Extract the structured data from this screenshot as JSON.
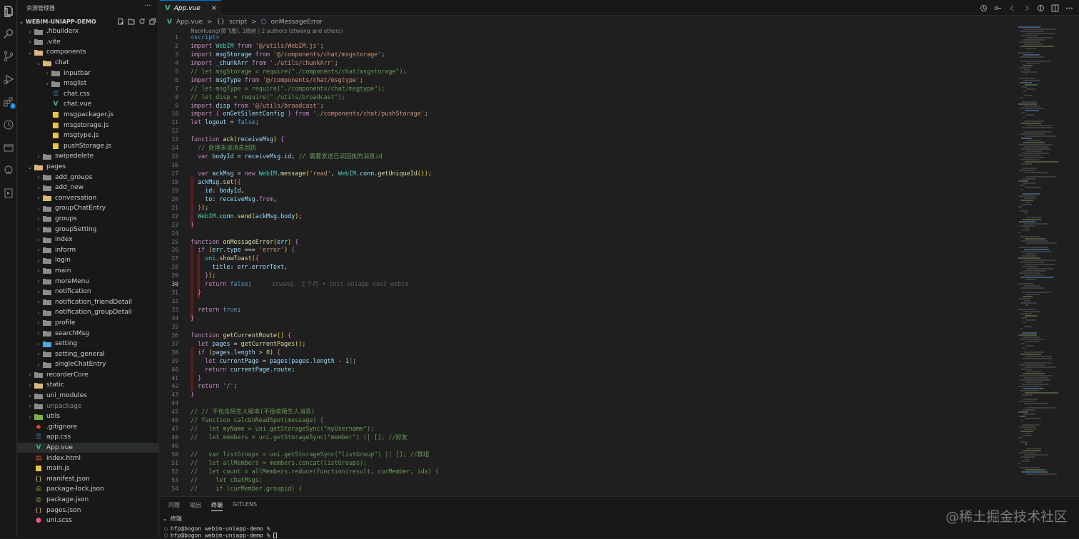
{
  "sidebar": {
    "title": "资源管理器",
    "more": "···",
    "project": "WEBIM-UNIAPP-DEMO",
    "tree": [
      {
        "label": "hbuilderx",
        "display": ".hbuilderx",
        "depth": 1,
        "kind": "folder",
        "open": false
      },
      {
        "label": ".vite",
        "display": ".vite",
        "depth": 1,
        "kind": "folder",
        "open": false
      },
      {
        "label": "components",
        "display": "components",
        "depth": 1,
        "kind": "folder-special",
        "open": true
      },
      {
        "label": "chat",
        "display": "chat",
        "depth": 2,
        "kind": "folder-special",
        "open": true
      },
      {
        "label": "inputbar",
        "display": "inputbar",
        "depth": 3,
        "kind": "folder",
        "open": false
      },
      {
        "label": "msglist",
        "display": "msglist",
        "depth": 3,
        "kind": "folder",
        "open": false
      },
      {
        "label": "chat.css",
        "display": "chat.css",
        "depth": 3,
        "kind": "css",
        "leaf": true
      },
      {
        "label": "chat.vue",
        "display": "chat.vue",
        "depth": 3,
        "kind": "vue",
        "leaf": true
      },
      {
        "label": "msgpackager.js",
        "display": "msgpackager.js",
        "depth": 3,
        "kind": "js",
        "leaf": true
      },
      {
        "label": "msgstorage.js",
        "display": "msgstorage.js",
        "depth": 3,
        "kind": "js",
        "leaf": true
      },
      {
        "label": "msgtype.js",
        "display": "msgtype.js",
        "depth": 3,
        "kind": "js",
        "leaf": true
      },
      {
        "label": "pushStorage.js",
        "display": "pushStorage.js",
        "depth": 3,
        "kind": "js",
        "leaf": true
      },
      {
        "label": "swipedelete",
        "display": "swipedelete",
        "depth": 2,
        "kind": "folder",
        "open": false
      },
      {
        "label": "pages",
        "display": "pages",
        "depth": 1,
        "kind": "folder-special",
        "open": true
      },
      {
        "label": "add_groups",
        "display": "add_groups",
        "depth": 2,
        "kind": "folder",
        "open": false
      },
      {
        "label": "add_new",
        "display": "add_new",
        "depth": 2,
        "kind": "folder",
        "open": false
      },
      {
        "label": "conversation",
        "display": "conversation",
        "depth": 2,
        "kind": "folder-special",
        "open": false
      },
      {
        "label": "groupChatEntry",
        "display": "groupChatEntry",
        "depth": 2,
        "kind": "folder",
        "open": false
      },
      {
        "label": "groups",
        "display": "groups",
        "depth": 2,
        "kind": "folder",
        "open": false
      },
      {
        "label": "groupSetting",
        "display": "groupSetting",
        "depth": 2,
        "kind": "folder",
        "open": false
      },
      {
        "label": "index",
        "display": "index",
        "depth": 2,
        "kind": "folder",
        "open": false
      },
      {
        "label": "inform",
        "display": "inform",
        "depth": 2,
        "kind": "folder",
        "open": false
      },
      {
        "label": "login",
        "display": "login",
        "depth": 2,
        "kind": "folder",
        "open": false
      },
      {
        "label": "main",
        "display": "main",
        "depth": 2,
        "kind": "folder",
        "open": false
      },
      {
        "label": "moreMenu",
        "display": "moreMenu",
        "depth": 2,
        "kind": "folder",
        "open": false
      },
      {
        "label": "notification",
        "display": "notification",
        "depth": 2,
        "kind": "folder",
        "open": false
      },
      {
        "label": "notification_friendDetail",
        "display": "notification_friendDetail",
        "depth": 2,
        "kind": "folder",
        "open": false
      },
      {
        "label": "notification_groupDetail",
        "display": "notification_groupDetail",
        "depth": 2,
        "kind": "folder",
        "open": false
      },
      {
        "label": "profile",
        "display": "profile",
        "depth": 2,
        "kind": "folder",
        "open": false
      },
      {
        "label": "searchMsg",
        "display": "searchMsg",
        "depth": 2,
        "kind": "folder",
        "open": false
      },
      {
        "label": "setting",
        "display": "setting",
        "depth": 2,
        "kind": "folder-setting",
        "open": false
      },
      {
        "label": "setting_general",
        "display": "setting_general",
        "depth": 2,
        "kind": "folder",
        "open": false
      },
      {
        "label": "singleChatEntry",
        "display": "singleChatEntry",
        "depth": 2,
        "kind": "folder",
        "open": false
      },
      {
        "label": "recorderCore",
        "display": "recorderCore",
        "depth": 1,
        "kind": "folder",
        "open": false
      },
      {
        "label": "static",
        "display": "static",
        "depth": 1,
        "kind": "folder-special",
        "open": false
      },
      {
        "label": "uni_modules",
        "display": "uni_modules",
        "depth": 1,
        "kind": "folder",
        "open": false
      },
      {
        "label": "unpackage",
        "display": "unpackage",
        "depth": 1,
        "kind": "folder",
        "open": false,
        "dim": true
      },
      {
        "label": "utils",
        "display": "utils",
        "depth": 1,
        "kind": "folder-green",
        "open": false
      },
      {
        "label": ".gitignore",
        "display": ".gitignore",
        "depth": 1,
        "kind": "git",
        "leaf": true
      },
      {
        "label": "app.css",
        "display": "app.css",
        "depth": 1,
        "kind": "css",
        "leaf": true
      },
      {
        "label": "App.vue",
        "display": "App.vue",
        "depth": 1,
        "kind": "vue",
        "leaf": true,
        "selected": true
      },
      {
        "label": "index.html",
        "display": "index.html",
        "depth": 1,
        "kind": "html",
        "leaf": true
      },
      {
        "label": "main.js",
        "display": "main.js",
        "depth": 1,
        "kind": "js",
        "leaf": true
      },
      {
        "label": "manifest.json",
        "display": "manifest.json",
        "depth": 1,
        "kind": "json",
        "leaf": true
      },
      {
        "label": "package-lock.json",
        "display": "package-lock.json",
        "depth": 1,
        "kind": "npm",
        "leaf": true
      },
      {
        "label": "package.json",
        "display": "package.json",
        "depth": 1,
        "kind": "npm",
        "leaf": true
      },
      {
        "label": "pages.json",
        "display": "pages.json",
        "depth": 1,
        "kind": "json",
        "leaf": true
      },
      {
        "label": "uni.scss",
        "display": "uni.scss",
        "depth": 1,
        "kind": "scss",
        "leaf": true
      }
    ]
  },
  "editor": {
    "tab_icon": "V",
    "tab_label": "App.vue",
    "tab_close": "×",
    "breadcrumb": {
      "file": "App.vue",
      "sep": ">",
      "section_icon": "{}",
      "section": "script",
      "symbol": "onMessageError"
    },
    "blame_header": "NeoHuang(黄飞鹏), 3周前 | 2 authors (stwang and others)",
    "current_line": 30,
    "inline_blame": "stwang, 上个月 • init uniapp vue3 webim",
    "lines": [
      "<script>",
      "import WebIM from '@/utils/WebIM.js';",
      "import msgStorage from '@/components/chat/msgstorage';",
      "import _chunkArr from './utils/chunkArr';",
      "// let msgStorage = require(\"./components/chat/msgstorage\");",
      "import msgType from '@/components/chat/msgtype';",
      "// let msgType = require(\"./components/chat/msgtype\");",
      "// let disp = require(\"./utils/broadcast\");",
      "import disp from '@/utils/broadcast';",
      "import { onGetSilentConfig } from './components/chat/pushStorage';",
      "let logout = false;",
      "",
      "function ack(receiveMsg) {",
      "  // 处理未读消息回执",
      "  var bodyId = receiveMsg.id; // 需要发送已读回执的消息id",
      "",
      "  var ackMsg = new WebIM.message('read', WebIM.conn.getUniqueId());",
      "  ackMsg.set({",
      "    id: bodyId,",
      "    to: receiveMsg.from,",
      "  });",
      "  WebIM.conn.send(ackMsg.body);",
      "}",
      "",
      "function onMessageError(err) {",
      "  if (err.type === 'error') {",
      "    uni.showToast({",
      "      title: err.errorText,",
      "    });",
      "    return false;",
      "  }",
      "",
      "  return true;",
      "}",
      "",
      "function getCurrentRoute() {",
      "  let pages = getCurrentPages();",
      "  if (pages.length > 0) {",
      "    let currentPage = pages[pages.length - 1];",
      "    return currentPage.route;",
      "  }",
      "  return '/';",
      "}",
      "",
      "// // 不包含陌生人版本(不接收陌生人消息)",
      "// function calcUnReadSpot(message) {",
      "//   let myName = uni.getStorageSync(\"myUsername\");",
      "//   let members = uni.getStorageSync(\"member\") || []; //好友",
      "",
      "//   var listGroups = uni.getStorageSync(\"listGroup\") || []; //群组",
      "//   let allMembers = members.concat(listGroups);",
      "//   let count = allMembers.reduce(function(result, curMember, idx) {",
      "//     let chatMsgs;",
      "//     if (curMember.groupid) {"
    ]
  },
  "panel": {
    "tabs": [
      "问题",
      "输出",
      "终端",
      "GITLENS"
    ],
    "active_tab": "终端",
    "section": "终端",
    "terminal_lines": [
      "hfp@bogon webim-uniapp-demo %",
      "hfp@bogon webim-uniapp-demo %"
    ]
  },
  "watermark": "@稀土掘金技术社区",
  "colors": {
    "accent": "#0078d4",
    "vue": "#42b883",
    "folder": "#c09553",
    "js": "#e8c547",
    "css": "#519aba"
  }
}
